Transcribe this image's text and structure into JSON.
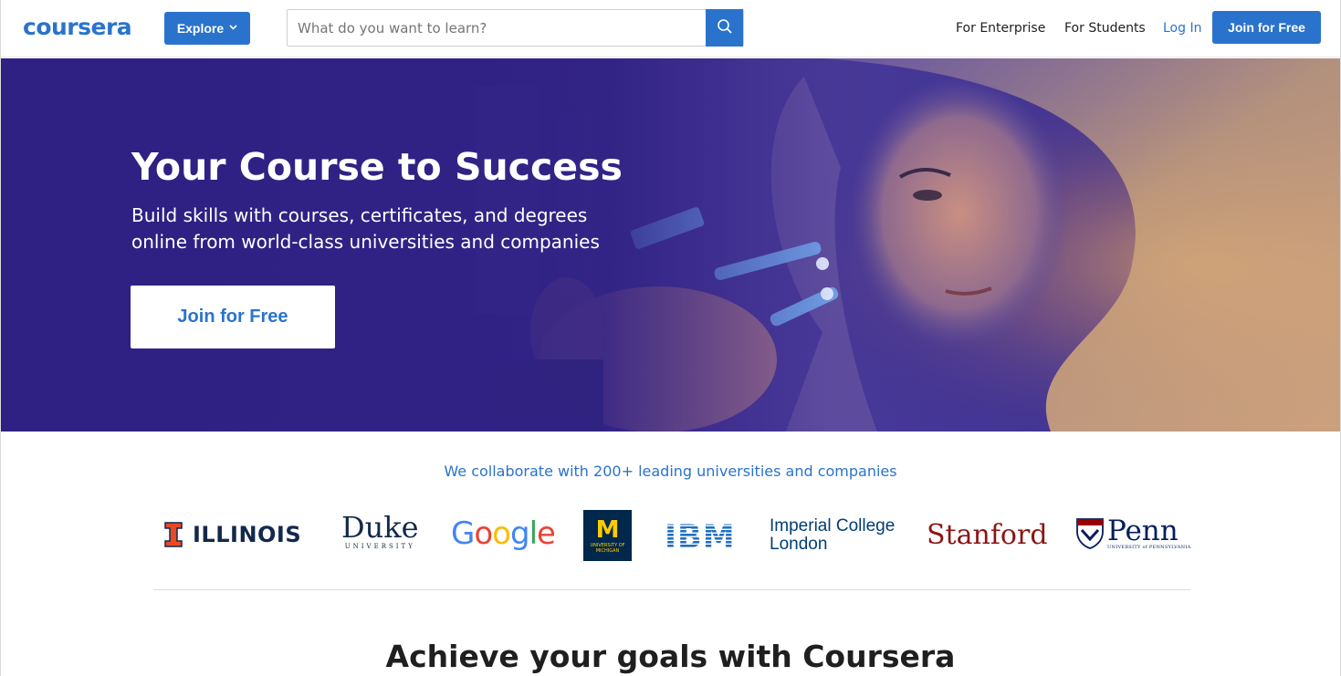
{
  "colors": {
    "brand": "#2a73cc",
    "hero_bg": "#3a2b8f",
    "text": "#1f1f1f",
    "white": "#ffffff"
  },
  "header": {
    "logo_text": "coursera",
    "explore_label": "Explore",
    "explore_icon": "chevron-down-icon",
    "search": {
      "placeholder": "What do you want to learn?",
      "value": "",
      "icon": "search-icon"
    },
    "nav": {
      "enterprise": "For Enterprise",
      "students": "For Students",
      "login": "Log In",
      "join": "Join for Free"
    }
  },
  "hero": {
    "title": "Your Course to Success",
    "subtitle": "Build skills with courses, certificates, and degrees online from world-class universities and companies",
    "cta": "Join for Free"
  },
  "partners": {
    "heading": "We collaborate with 200+ leading universities and companies",
    "logos": [
      {
        "name": "ILLINOIS"
      },
      {
        "name": "Duke",
        "sub": "UNIVERSITY"
      },
      {
        "name": "Google"
      },
      {
        "name": "M",
        "sub": "UNIVERSITY OF MICHIGAN"
      },
      {
        "name": "IBM"
      },
      {
        "name": "Imperial College",
        "line2": "London"
      },
      {
        "name": "Stanford"
      },
      {
        "name": "Penn",
        "sub": "UNIVERSITY of PENNSYLVANIA"
      }
    ]
  },
  "goals": {
    "title": "Achieve your goals with Coursera"
  }
}
